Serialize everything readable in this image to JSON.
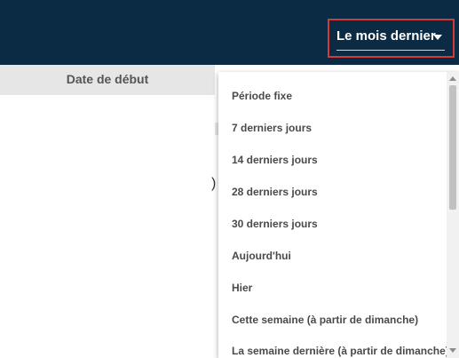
{
  "header": {
    "period_button_label": "Le mois dernier"
  },
  "table": {
    "start_date_header": "Date de début",
    "partial_glyph": ")"
  },
  "dropdown": {
    "options": [
      "Période fixe",
      "7 derniers jours",
      "14 derniers jours",
      "28 derniers jours",
      "30 derniers jours",
      "Aujourd'hui",
      "Hier",
      "Cette semaine (à partir de dimanche)",
      "La semaine dernière (à partir de dimanche)"
    ]
  },
  "colors": {
    "topbar": "#0b2a43",
    "highlight_border": "#d33b3b",
    "header_bg": "#e6e6e6"
  },
  "icons": {
    "period_button": "chevron-down-icon",
    "scroll_up": "scroll-up-arrow-icon",
    "scroll_down": "scroll-down-arrow-icon"
  }
}
